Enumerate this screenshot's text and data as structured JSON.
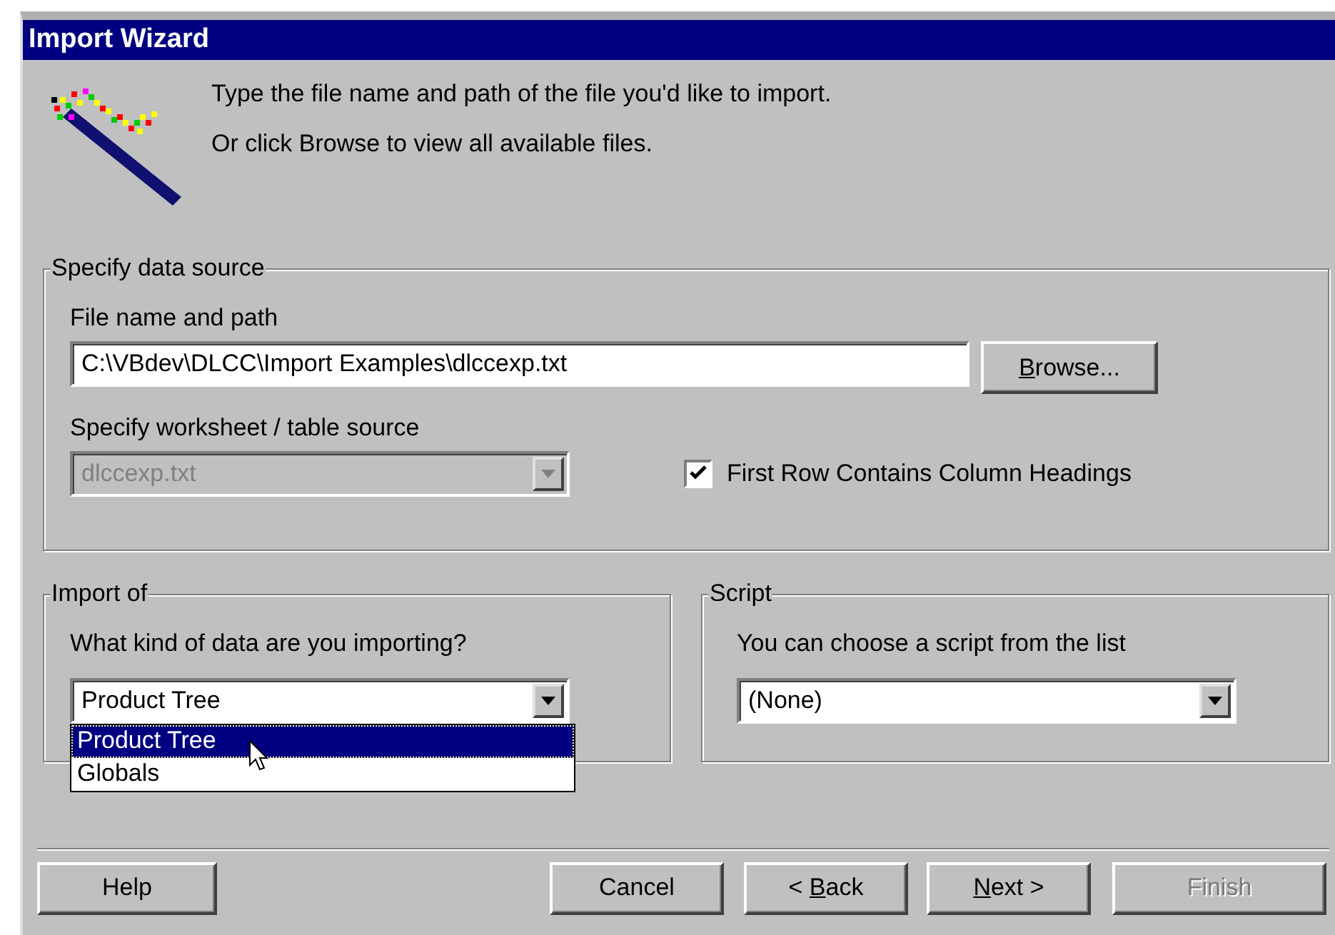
{
  "window": {
    "title": "Import Wizard"
  },
  "instructions": [
    "Type the file name and path of the file you'd like to import.",
    "Or click Browse to view all available files."
  ],
  "data_source": {
    "title": "Specify data source",
    "file_label": "File name and path",
    "file_value": "C:\\VBdev\\DLCC\\Import Examples\\dlccexp.txt",
    "browse_button": {
      "label": "Browse...",
      "access_key_underlined": true
    },
    "worksheet_label": "Specify worksheet / table source",
    "worksheet": {
      "value": "dlccexp.txt",
      "disabled": true
    },
    "first_row_headings": {
      "label": "First Row Contains Column Headings",
      "checked": true
    }
  },
  "import_of": {
    "title": "Import of",
    "question": "What kind of data are you importing?",
    "value": "Product Tree",
    "expanded": true,
    "options": [
      {
        "label": "Product Tree",
        "selected": true
      },
      {
        "label": "Globals",
        "selected": false
      }
    ]
  },
  "script": {
    "title": "Script",
    "hint": "You can choose a script from the list",
    "value": "(None)"
  },
  "buttons": [
    {
      "label": "Help",
      "disabled": false
    },
    {
      "label": "Cancel",
      "disabled": false
    },
    {
      "label": "< Back",
      "access_key_underlined": true,
      "disabled": false
    },
    {
      "label": "Next >",
      "access_key_underlined": true,
      "disabled": false
    },
    {
      "label": "Finish",
      "disabled": true
    }
  ]
}
